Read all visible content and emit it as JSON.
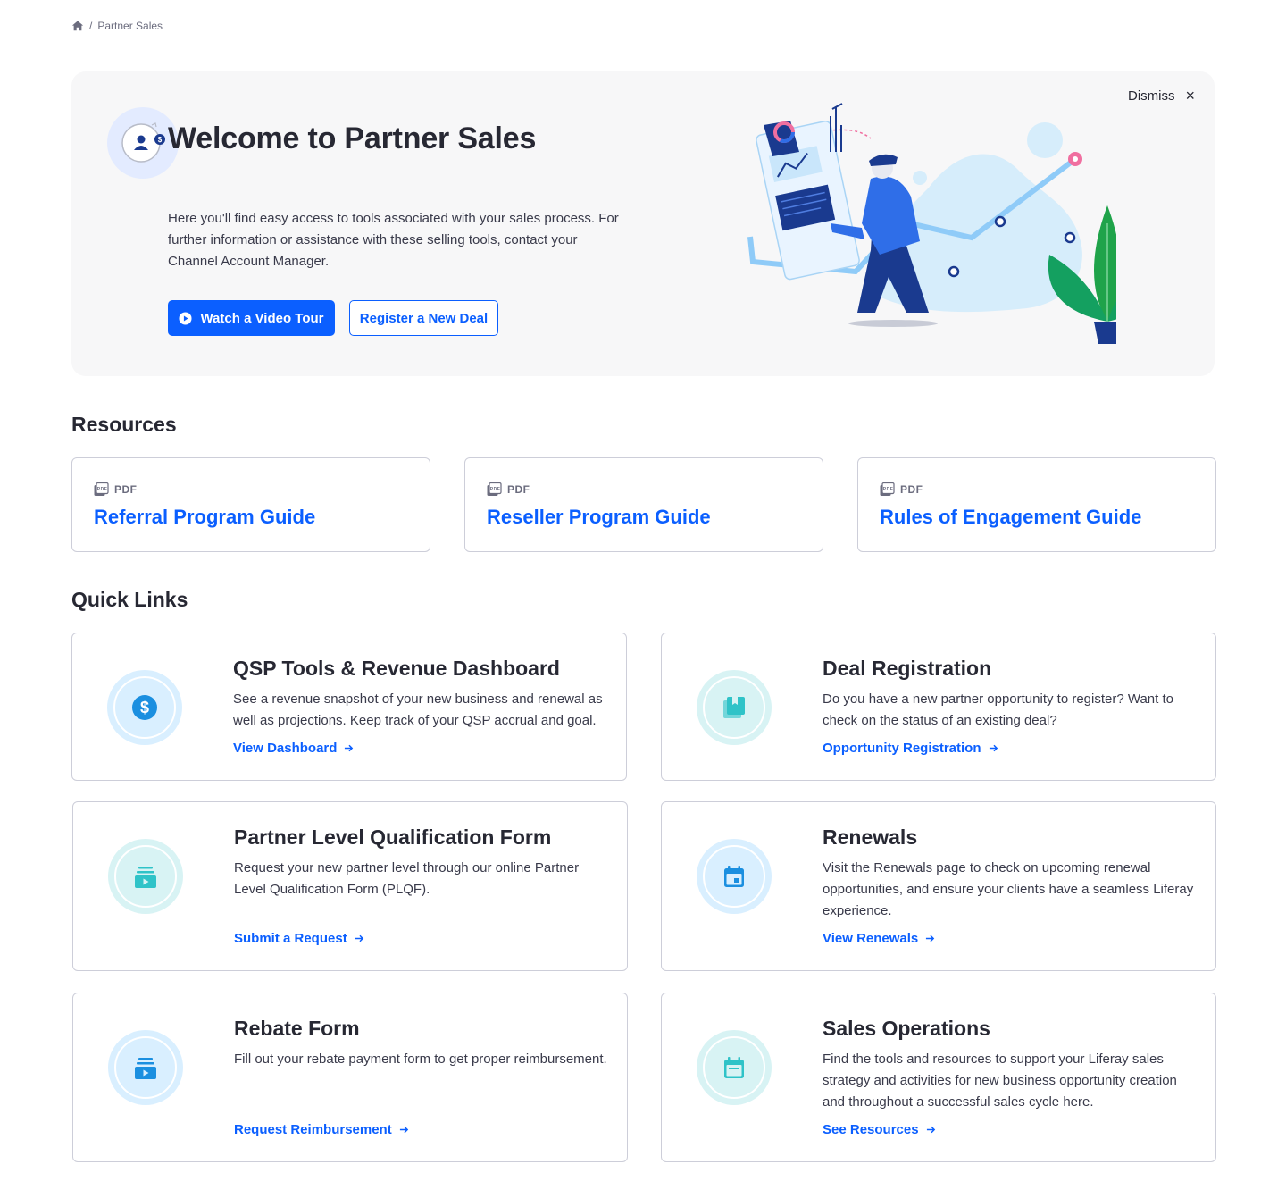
{
  "breadcrumb": {
    "current": "Partner Sales",
    "separator": "/"
  },
  "hero": {
    "title": "Welcome to Partner Sales",
    "description": "Here you'll find easy access to tools associated with your sales process. For further information or assistance with these selling tools, contact your Channel Account Manager.",
    "dismiss_label": "Dismiss",
    "primary_button": "Watch a Video Tour",
    "secondary_button": "Register a New Deal"
  },
  "resources": {
    "title": "Resources",
    "items": [
      {
        "type": "PDF",
        "title": "Referral Program Guide",
        "icon": "pdf-icon"
      },
      {
        "type": "PDF",
        "title": "Reseller Program Guide",
        "icon": "pdf-icon"
      },
      {
        "type": "PDF",
        "title": "Rules of Engagement Guide",
        "icon": "pdf-icon"
      }
    ]
  },
  "quick_links": {
    "title": "Quick Links",
    "items": [
      {
        "title": "QSP Tools & Revenue Dashboard",
        "description": "See a revenue snapshot of your new business and renewal as well as projections. Keep track of your QSP accrual and goal.",
        "link": "View Dashboard",
        "icon": "dollar-icon"
      },
      {
        "title": "Deal Registration",
        "description": "Do you have a new partner opportunity to register? Want to check on the status of an existing deal?",
        "link": "Opportunity Registration",
        "icon": "book-icon"
      },
      {
        "title": "Partner Level Qualification Form",
        "description": "Request your new partner level through our online Partner Level Qualification Form (PLQF).",
        "link": "Submit a Request",
        "icon": "media-stack-icon"
      },
      {
        "title": "Renewals",
        "description": "Visit the Renewals page to check on upcoming renewal opportunities, and ensure your clients have a seamless Liferay experience.",
        "link": "View Renewals",
        "icon": "calendar-icon"
      },
      {
        "title": "Rebate Form",
        "description": "Fill out your rebate payment form to get proper reimbursement.",
        "link": "Request Reimbursement",
        "icon": "media-stack-icon"
      },
      {
        "title": "Sales Operations",
        "description": "Find the tools and resources to support your Liferay sales strategy and activities for new business opportunity creation and throughout a successful sales cycle here.",
        "link": "See Resources",
        "icon": "calendar-icon"
      }
    ]
  },
  "colors": {
    "accent": "#0b5fff",
    "text": "#272833",
    "muted": "#6b6c7e",
    "hero_bg": "#f7f7f8",
    "teal": "#2fc3c8",
    "light_blue": "#d9efff"
  }
}
